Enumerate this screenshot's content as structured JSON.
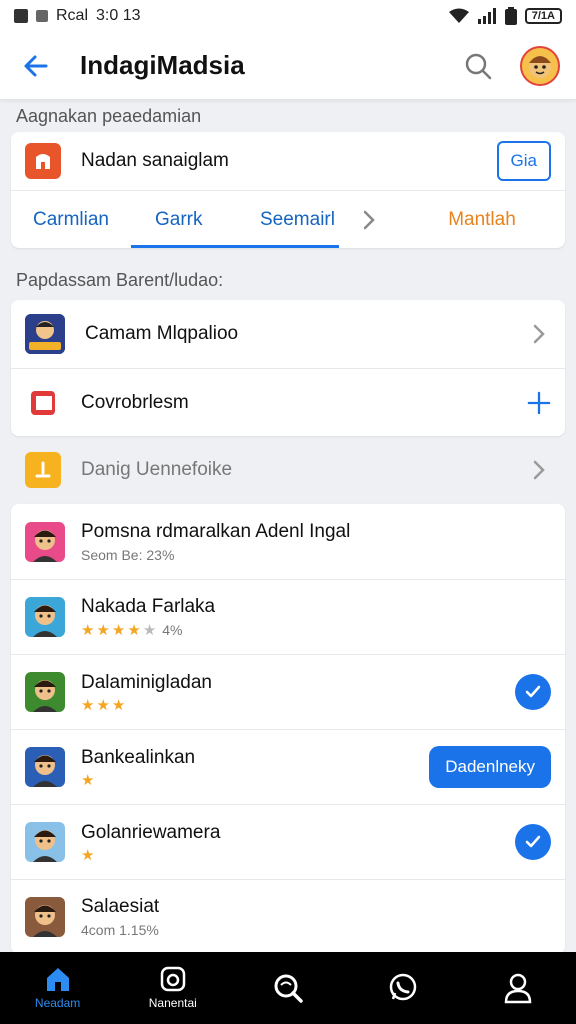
{
  "status": {
    "carrier": "Rcal",
    "time": "3:0 13",
    "battery": "7/1A"
  },
  "appbar": {
    "title": "IndagiMadsia"
  },
  "section1": {
    "label": "Aagnakan peaedamian"
  },
  "feature": {
    "label": "Nadan sanaiglam",
    "button": "Gia"
  },
  "tabs": [
    {
      "label": "Carmlian"
    },
    {
      "label": "Garrk"
    },
    {
      "label": "Seemairl"
    },
    {
      "label": "Mantlah"
    }
  ],
  "section2": {
    "label": "Papdassam Barent/ludao:"
  },
  "menu": [
    {
      "label": "Camam Mlqpalioo"
    },
    {
      "label": "Covrobrlesm"
    },
    {
      "label": "Danig Uennefoike"
    }
  ],
  "games": [
    {
      "name": "Pomsna rdmaralkan Adenl Ingal",
      "sub": "Seom Be: 23%",
      "stars": 0,
      "action": "none",
      "thumb_bg": "#e84a8a"
    },
    {
      "name": "Nakada Farlaka",
      "sub": "4%",
      "stars": 4,
      "action": "none",
      "thumb_bg": "#3aa7d8"
    },
    {
      "name": "Dalaminigladan",
      "sub": "",
      "stars": 3,
      "action": "check",
      "thumb_bg": "#3d8b2e"
    },
    {
      "name": "Bankealinkan",
      "sub": "",
      "stars": 1,
      "action": "button",
      "button_label": "Dadenlneky",
      "thumb_bg": "#2b5fb5"
    },
    {
      "name": "Golanriewamera",
      "sub": "",
      "stars": 1,
      "action": "check",
      "thumb_bg": "#88c0e8"
    },
    {
      "name": "Salaesiat",
      "sub": "4com 1.15%",
      "stars": 0,
      "action": "none",
      "thumb_bg": "#8a5a3c"
    }
  ],
  "nav": [
    {
      "label": "Neadam",
      "icon": "home-icon",
      "active": true
    },
    {
      "label": "Nanentai",
      "icon": "camera-icon",
      "active": false
    },
    {
      "label": "",
      "icon": "search-icon",
      "active": false
    },
    {
      "label": "",
      "icon": "whatsapp-icon",
      "active": false
    },
    {
      "label": "",
      "icon": "profile-icon",
      "active": false
    }
  ],
  "colors": {
    "accent": "#1a73e8",
    "orange": "#e8821e",
    "star": "#f4a623"
  }
}
